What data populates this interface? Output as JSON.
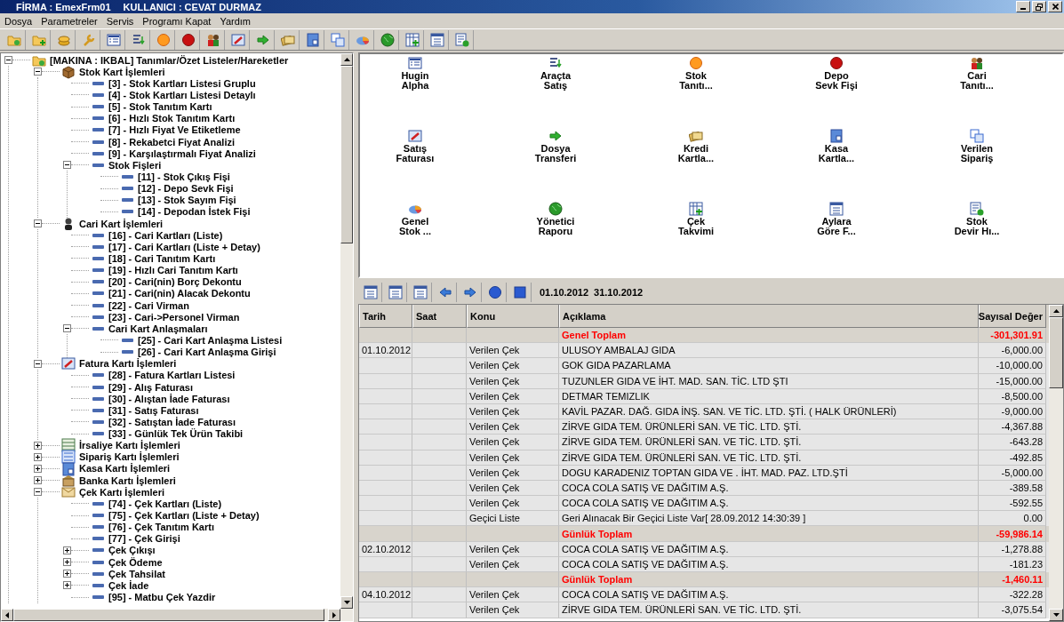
{
  "window": {
    "firma": "FİRMA : EmexFrm01",
    "user": "KULLANICI : CEVAT DURMAZ"
  },
  "menu": [
    "Dosya",
    "Parametreler",
    "Servis",
    "Programı Kapat",
    "Yardım"
  ],
  "tree": {
    "label": "[MAKINA : IKBAL] Tanımlar/Özet Listeler/Hareketler",
    "expanded": true,
    "children": [
      {
        "label": "Stok Kart İşlemleri",
        "expanded": true,
        "children": [
          {
            "label": "[3] - Stok Kartları Listesi Gruplu"
          },
          {
            "label": "[4] - Stok Kartları Listesi Detaylı"
          },
          {
            "label": "[5] - Stok Tanıtım Kartı"
          },
          {
            "label": "[6] - Hızlı Stok Tanıtım Kartı"
          },
          {
            "label": "[7] - Hızlı Fiyat Ve Etiketleme"
          },
          {
            "label": "[8] - Rekabetci Fiyat Analizi"
          },
          {
            "label": "[9] - Karşılaştırmalı Fiyat Analizi"
          },
          {
            "label": "Stok Fişleri",
            "expanded": true,
            "children": [
              {
                "label": "[11] - Stok Çıkış Fişi"
              },
              {
                "label": "[12] - Depo Sevk Fişi"
              },
              {
                "label": "[13] - Stok Sayım Fişi"
              },
              {
                "label": "[14] - Depodan İstek Fişi"
              }
            ]
          }
        ]
      },
      {
        "label": "Cari Kart İşlemleri",
        "expanded": true,
        "children": [
          {
            "label": "[16] - Cari Kartları (Liste)"
          },
          {
            "label": "[17] - Cari Kartları (Liste + Detay)"
          },
          {
            "label": "[18] - Cari Tanıtım Kartı"
          },
          {
            "label": "[19] - Hızlı Cari Tanıtım Kartı"
          },
          {
            "label": "[20] - Cari(nin) Borç Dekontu"
          },
          {
            "label": "[21] - Cari(nin) Alacak Dekontu"
          },
          {
            "label": "[22] - Cari Virman"
          },
          {
            "label": "[23] - Cari->Personel Virman"
          },
          {
            "label": "Cari Kart Anlaşmaları",
            "expanded": true,
            "children": [
              {
                "label": "[25] - Cari Kart Anlaşma Listesi"
              },
              {
                "label": "[26] - Cari Kart Anlaşma Girişi"
              }
            ]
          }
        ]
      },
      {
        "label": "Fatura Kartı İşlemleri",
        "expanded": true,
        "children": [
          {
            "label": "[28] - Fatura Kartları Listesi"
          },
          {
            "label": "[29] - Alış Faturası"
          },
          {
            "label": "[30] - Alıştan İade Faturası"
          },
          {
            "label": "[31] - Satış Faturası"
          },
          {
            "label": "[32] - Satıştan İade Faturası"
          },
          {
            "label": "[33] - Günlük Tek Ürün Takibi"
          }
        ]
      },
      {
        "label": "İrsaliye Kartı İşlemleri",
        "expanded": false
      },
      {
        "label": "Sipariş Kartı İşlemleri",
        "expanded": false
      },
      {
        "label": "Kasa Kartı İşlemleri",
        "expanded": false
      },
      {
        "label": "Banka Kartı İşlemleri",
        "expanded": false
      },
      {
        "label": "Çek Kartı İşlemleri",
        "expanded": true,
        "children": [
          {
            "label": "[74] - Çek Kartları (Liste)"
          },
          {
            "label": "[75] - Çek Kartları (Liste + Detay)"
          },
          {
            "label": "[76] - Çek Tanıtım Kartı"
          },
          {
            "label": "[77] - Çek Girişi"
          },
          {
            "label": "Çek Çıkışı",
            "expanded": false
          },
          {
            "label": "Çek Ödeme",
            "expanded": false
          },
          {
            "label": "Çek Tahsilat",
            "expanded": false
          },
          {
            "label": "Çek İade",
            "expanded": false
          },
          {
            "label": "[95] - Matbu Çek Yazdir"
          }
        ]
      }
    ]
  },
  "launchers": [
    "Hugin\nAlpha",
    "Araçta\nSatış",
    "Stok\nTanıtı...",
    "Depo\nSevk Fişi",
    "Cari\nTanıtı...",
    "Satış\nFaturası",
    "Dosya\nTransferi",
    "Kredi\nKartla...",
    "Kasa\nKartla...",
    "Verilen\nSipariş",
    "Genel\nStok ...",
    "Yönetici\nRaporu",
    "Çek\nTakvimi",
    "Aylara\nGöre F...",
    "Stok\nDevir Hı..."
  ],
  "date_range": {
    "start": "01.10.2012",
    "end": "31.10.2012"
  },
  "table": {
    "columns": [
      "Tarih",
      "Saat",
      "Konu",
      "Açıklama",
      "Sayısal Değer"
    ],
    "rows": [
      {
        "kind": "total",
        "aciklama": "Genel Toplam",
        "deger": "-301,301.91"
      },
      {
        "kind": "entry",
        "tarih": "01.10.2012",
        "konu": "Verilen Çek",
        "aciklama": "ULUSOY AMBALAJ GIDA",
        "deger": "-6,000.00"
      },
      {
        "kind": "entry",
        "konu": "Verilen Çek",
        "aciklama": "GOK GIDA PAZARLAMA",
        "deger": "-10,000.00"
      },
      {
        "kind": "entry",
        "konu": "Verilen Çek",
        "aciklama": "TUZUNLER GIDA VE İHT. MAD. SAN. TİC. LTD ŞTI",
        "deger": "-15,000.00"
      },
      {
        "kind": "entry",
        "konu": "Verilen Çek",
        "aciklama": "DETMAR TEMIZLIK",
        "deger": "-8,500.00"
      },
      {
        "kind": "entry",
        "konu": "Verilen Çek",
        "aciklama": "KAVİL PAZAR. DAĞ. GIDA İNŞ. SAN. VE TİC. LTD. ŞTİ.  ( HALK ÜRÜNLERİ)",
        "deger": "-9,000.00"
      },
      {
        "kind": "entry",
        "konu": "Verilen Çek",
        "aciklama": "ZİRVE GIDA TEM. ÜRÜNLERİ SAN. VE TİC. LTD. ŞTİ.",
        "deger": "-4,367.88"
      },
      {
        "kind": "entry",
        "konu": "Verilen Çek",
        "aciklama": "ZİRVE GIDA TEM. ÜRÜNLERİ SAN. VE TİC. LTD. ŞTİ.",
        "deger": "-643.28"
      },
      {
        "kind": "entry",
        "konu": "Verilen Çek",
        "aciklama": "ZİRVE GIDA TEM. ÜRÜNLERİ SAN. VE TİC. LTD. ŞTİ.",
        "deger": "-492.85"
      },
      {
        "kind": "entry",
        "konu": "Verilen Çek",
        "aciklama": "DOGU KARADENIZ TOPTAN GIDA VE . İHT. MAD. PAZ. LTD.ŞTİ",
        "deger": "-5,000.00"
      },
      {
        "kind": "entry",
        "konu": "Verilen Çek",
        "aciklama": "COCA COLA SATIŞ VE DAĞITIM A.Ş.",
        "deger": "-389.58"
      },
      {
        "kind": "entry",
        "konu": "Verilen Çek",
        "aciklama": "COCA COLA SATIŞ VE DAĞITIM A.Ş.",
        "deger": "-592.55"
      },
      {
        "kind": "entry",
        "konu": "Geçici Liste",
        "aciklama": "Geri Alınacak Bir Geçici Liste Var[ 28.09.2012 14:30:39 ]",
        "deger": "0.00"
      },
      {
        "kind": "total",
        "aciklama": "Günlük Toplam",
        "deger": "-59,986.14"
      },
      {
        "kind": "entry",
        "tarih": "02.10.2012",
        "konu": "Verilen Çek",
        "aciklama": "COCA COLA SATIŞ VE DAĞITIM A.Ş.",
        "deger": "-1,278.88"
      },
      {
        "kind": "entry",
        "konu": "Verilen Çek",
        "aciklama": "COCA COLA SATIŞ VE DAĞITIM A.Ş.",
        "deger": "-181.23"
      },
      {
        "kind": "total",
        "aciklama": "Günlük Toplam",
        "deger": "-1,460.11"
      },
      {
        "kind": "entry",
        "tarih": "04.10.2012",
        "konu": "Verilen Çek",
        "aciklama": "COCA COLA SATIŞ VE DAĞITIM A.Ş.",
        "deger": "-322.28"
      },
      {
        "kind": "entry",
        "konu": "Verilen Çek",
        "aciklama": "ZİRVE GIDA TEM. ÜRÜNLERİ SAN. VE TİC. LTD. ŞTİ.",
        "deger": "-3,075.54"
      }
    ]
  }
}
